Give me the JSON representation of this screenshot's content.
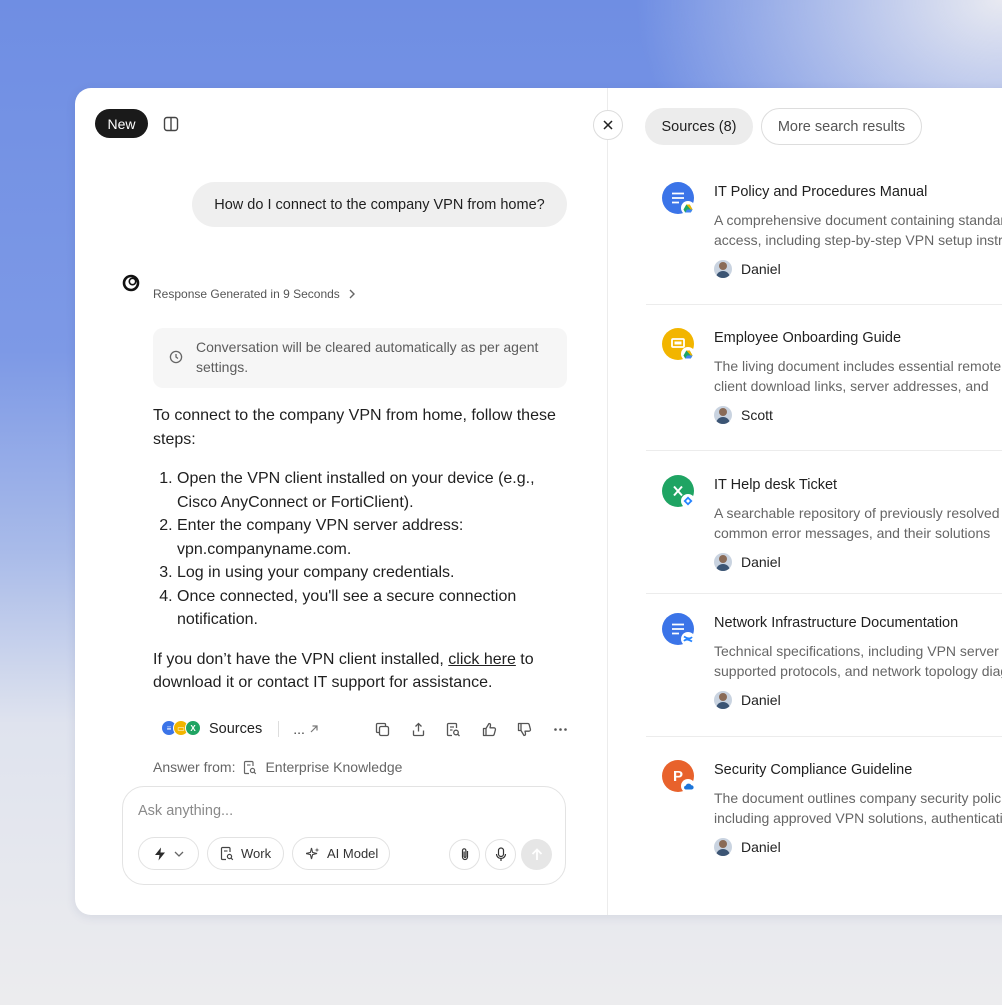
{
  "left": {
    "new_label": "New",
    "user_message": "How do I connect to the company VPN from home?",
    "response_meta": "Response Generated in 9 Seconds",
    "notice": "Conversation will be cleared automatically as per agent settings.",
    "intro": "To connect to the company VPN from home, follow these steps:",
    "steps": [
      "Open the VPN client installed on your device (e.g., Cisco AnyConnect or FortiClient).",
      "Enter the company VPN server address: vpn.companyname.com.",
      "Log in using your company credentials.",
      "Once connected, you'll see a secure connection notification."
    ],
    "footer_before": "If you don’t have the VPN client installed, ",
    "footer_link": "click here",
    "footer_after": " to download it or contact IT support for assistance.",
    "sources_label": "Sources",
    "more_label": "...",
    "answer_from_label": "Answer from:",
    "answer_from_value": "Enterprise Knowledge",
    "composer": {
      "placeholder": "Ask anything...",
      "work_label": "Work",
      "model_label": "AI Model"
    }
  },
  "right": {
    "tabs": [
      "Sources (8)",
      "More search results"
    ],
    "cards": [
      {
        "title": "IT Policy and Procedures Manual",
        "desc1": "A comprehensive document containing standard",
        "desc2": "access, including step-by-step VPN setup instructions",
        "author": "Daniel",
        "icon_color": "#3b74e8",
        "icon": "doc-icon",
        "badge": "google-drive-icon"
      },
      {
        "title": "Employee Onboarding Guide",
        "desc1": "The living document includes essential remote",
        "desc2": "client download links, server addresses, and",
        "author": "Scott",
        "icon_color": "#f2b500",
        "icon": "slides-icon",
        "badge": "google-drive-icon"
      },
      {
        "title": "IT Help desk Ticket",
        "desc1": "A searchable repository of previously resolved",
        "desc2": "common error messages, and their solutions",
        "author": "Daniel",
        "icon_color": "#1fa463",
        "icon": "sheet-icon",
        "badge": "jira-icon"
      },
      {
        "title": "Network Infrastructure Documentation",
        "desc1": "Technical specifications, including VPN server",
        "desc2": "supported protocols, and network topology diagrams",
        "author": "Daniel",
        "icon_color": "#3b74e8",
        "icon": "doc-icon",
        "badge": "confluence-icon"
      },
      {
        "title": "Security Compliance Guideline",
        "desc1": "The document outlines company security policies",
        "desc2": "including approved VPN solutions, authentication",
        "author": "Daniel",
        "icon_color": "#e8622c",
        "icon": "powerpoint-icon",
        "badge": "onedrive-icon"
      }
    ]
  },
  "colors": {
    "primary_dark": "#1a1a1a",
    "link": "#1f1f1f"
  }
}
